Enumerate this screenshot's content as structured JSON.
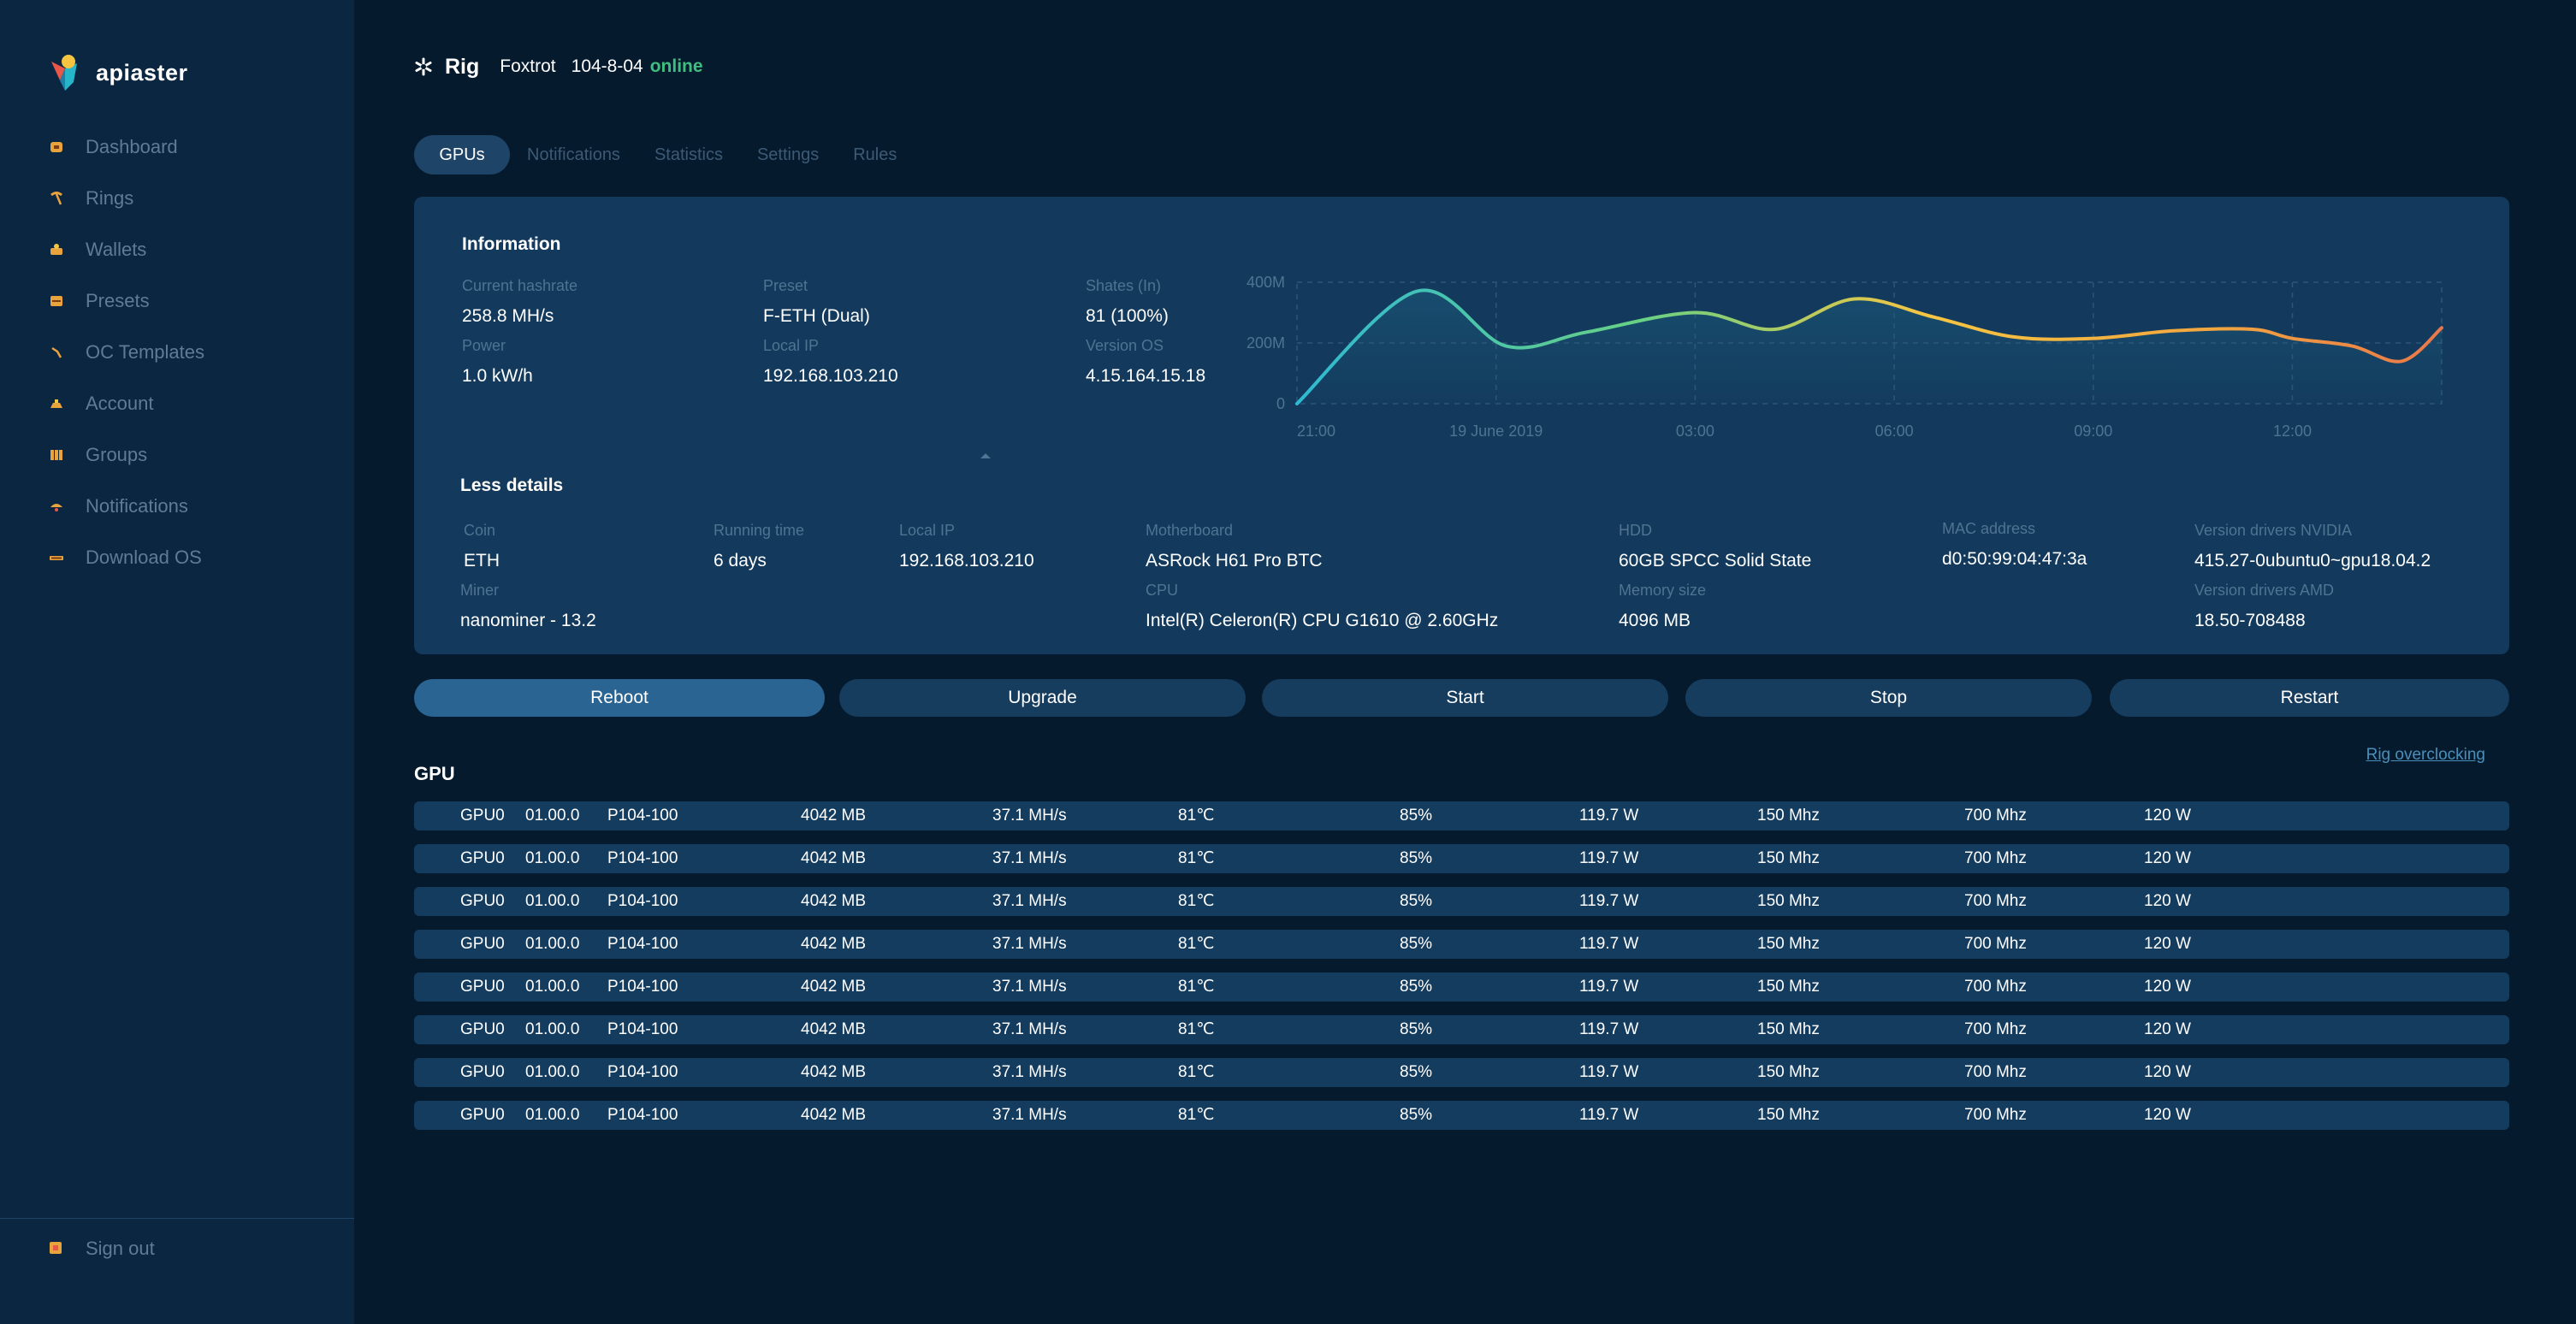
{
  "app": {
    "brand": "apiaster"
  },
  "sidebar": {
    "items": [
      {
        "label": "Dashboard",
        "icon": "dashboard-icon"
      },
      {
        "label": "Rings",
        "icon": "pickaxe-icon"
      },
      {
        "label": "Wallets",
        "icon": "wallet-icon"
      },
      {
        "label": "Presets",
        "icon": "preset-icon"
      },
      {
        "label": "OC Templates",
        "icon": "oc-template-icon"
      },
      {
        "label": "Account",
        "icon": "account-icon"
      },
      {
        "label": "Groups",
        "icon": "groups-icon"
      },
      {
        "label": "Notifications",
        "icon": "notifications-icon"
      },
      {
        "label": "Download OS",
        "icon": "download-icon"
      }
    ],
    "signout": "Sign out"
  },
  "header": {
    "title": "Rig",
    "rig_name": "Foxtrot",
    "rig_id": "104-8-04",
    "status": "online"
  },
  "tabs": [
    "GPUs",
    "Notifications",
    "Statistics",
    "Settings",
    "Rules"
  ],
  "information": {
    "title": "Information",
    "current_hashrate": {
      "label": "Current hashrate",
      "value": "258.8 MH/s"
    },
    "preset": {
      "label": "Preset",
      "value": "F-ETH (Dual)"
    },
    "shares": {
      "label": "Shates (In)",
      "value": "81 (100%)"
    },
    "power": {
      "label": "Power",
      "value": "1.0 kW/h"
    },
    "local_ip": {
      "label": "Local IP",
      "value": "192.168.103.210"
    },
    "version_os": {
      "label": "Version OS",
      "value": "4.15.164.15.18"
    }
  },
  "details": {
    "title": "Less details",
    "coin": {
      "label": "Coin",
      "value": "ETH"
    },
    "running_time": {
      "label": "Running time",
      "value": "6 days"
    },
    "local_ip": {
      "label": "Local IP",
      "value": "192.168.103.210"
    },
    "motherboard": {
      "label": "Motherboard",
      "value": "ASRock H61 Pro BTC"
    },
    "hdd": {
      "label": "HDD",
      "value": "60GB SPCC Solid State"
    },
    "mac": {
      "label": "MAC address",
      "value": "d0:50:99:04:47:3a"
    },
    "nvidia": {
      "label": "Version drivers NVIDIA",
      "value": "415.27-0ubuntu0~gpu18.04.2"
    },
    "miner": {
      "label": "Miner",
      "value": "nanominer - 13.2"
    },
    "cpu": {
      "label": "CPU",
      "value": "Intel(R) Celeron(R) CPU G1610 @ 2.60GHz"
    },
    "memory": {
      "label": "Memory size",
      "value": "4096 MB"
    },
    "amd": {
      "label": "Version drivers AMD",
      "value": "18.50-708488"
    }
  },
  "chart_data": {
    "type": "line",
    "x_labels": [
      "21:00",
      "19 June 2019",
      "03:00",
      "06:00",
      "09:00",
      "12:00"
    ],
    "y_labels": [
      "0",
      "200M",
      "400M"
    ],
    "x": [
      0,
      0.6,
      1.05,
      1.45,
      2.0,
      2.4,
      2.8,
      3.2,
      3.6,
      4.0,
      4.4,
      4.8,
      5.0,
      5.3,
      5.55,
      5.75
    ],
    "y": [
      0,
      370,
      190,
      235,
      300,
      245,
      345,
      285,
      220,
      215,
      240,
      245,
      215,
      190,
      140,
      250
    ],
    "ylim": [
      0,
      400
    ],
    "xlim": [
      0,
      5.75
    ],
    "grid": true,
    "colors": [
      "#2fb9d2",
      "#67d184",
      "#f5c542",
      "#e8784a"
    ]
  },
  "actions": [
    "Reboot",
    "Upgrade",
    "Start",
    "Stop",
    "Restart"
  ],
  "gpu": {
    "title": "GPU",
    "oc_link": "Rig overclocking",
    "rows": [
      [
        "GPU0",
        "01.00.0",
        "P104-100",
        "4042 MB",
        "37.1 MH/s",
        "81℃",
        "85%",
        "119.7 W",
        "150 Mhz",
        "700 Mhz",
        "120 W"
      ],
      [
        "GPU0",
        "01.00.0",
        "P104-100",
        "4042 MB",
        "37.1 MH/s",
        "81℃",
        "85%",
        "119.7 W",
        "150 Mhz",
        "700 Mhz",
        "120 W"
      ],
      [
        "GPU0",
        "01.00.0",
        "P104-100",
        "4042 MB",
        "37.1 MH/s",
        "81℃",
        "85%",
        "119.7 W",
        "150 Mhz",
        "700 Mhz",
        "120 W"
      ],
      [
        "GPU0",
        "01.00.0",
        "P104-100",
        "4042 MB",
        "37.1 MH/s",
        "81℃",
        "85%",
        "119.7 W",
        "150 Mhz",
        "700 Mhz",
        "120 W"
      ],
      [
        "GPU0",
        "01.00.0",
        "P104-100",
        "4042 MB",
        "37.1 MH/s",
        "81℃",
        "85%",
        "119.7 W",
        "150 Mhz",
        "700 Mhz",
        "120 W"
      ],
      [
        "GPU0",
        "01.00.0",
        "P104-100",
        "4042 MB",
        "37.1 MH/s",
        "81℃",
        "85%",
        "119.7 W",
        "150 Mhz",
        "700 Mhz",
        "120 W"
      ],
      [
        "GPU0",
        "01.00.0",
        "P104-100",
        "4042 MB",
        "37.1 MH/s",
        "81℃",
        "85%",
        "119.7 W",
        "150 Mhz",
        "700 Mhz",
        "120 W"
      ],
      [
        "GPU0",
        "01.00.0",
        "P104-100",
        "4042 MB",
        "37.1 MH/s",
        "81℃",
        "85%",
        "119.7 W",
        "150 Mhz",
        "700 Mhz",
        "120 W"
      ]
    ]
  },
  "colors": {
    "accent": "#2a6493",
    "online": "#3fbf7f",
    "link": "#4a8fba",
    "icon": "#e8a33d"
  }
}
